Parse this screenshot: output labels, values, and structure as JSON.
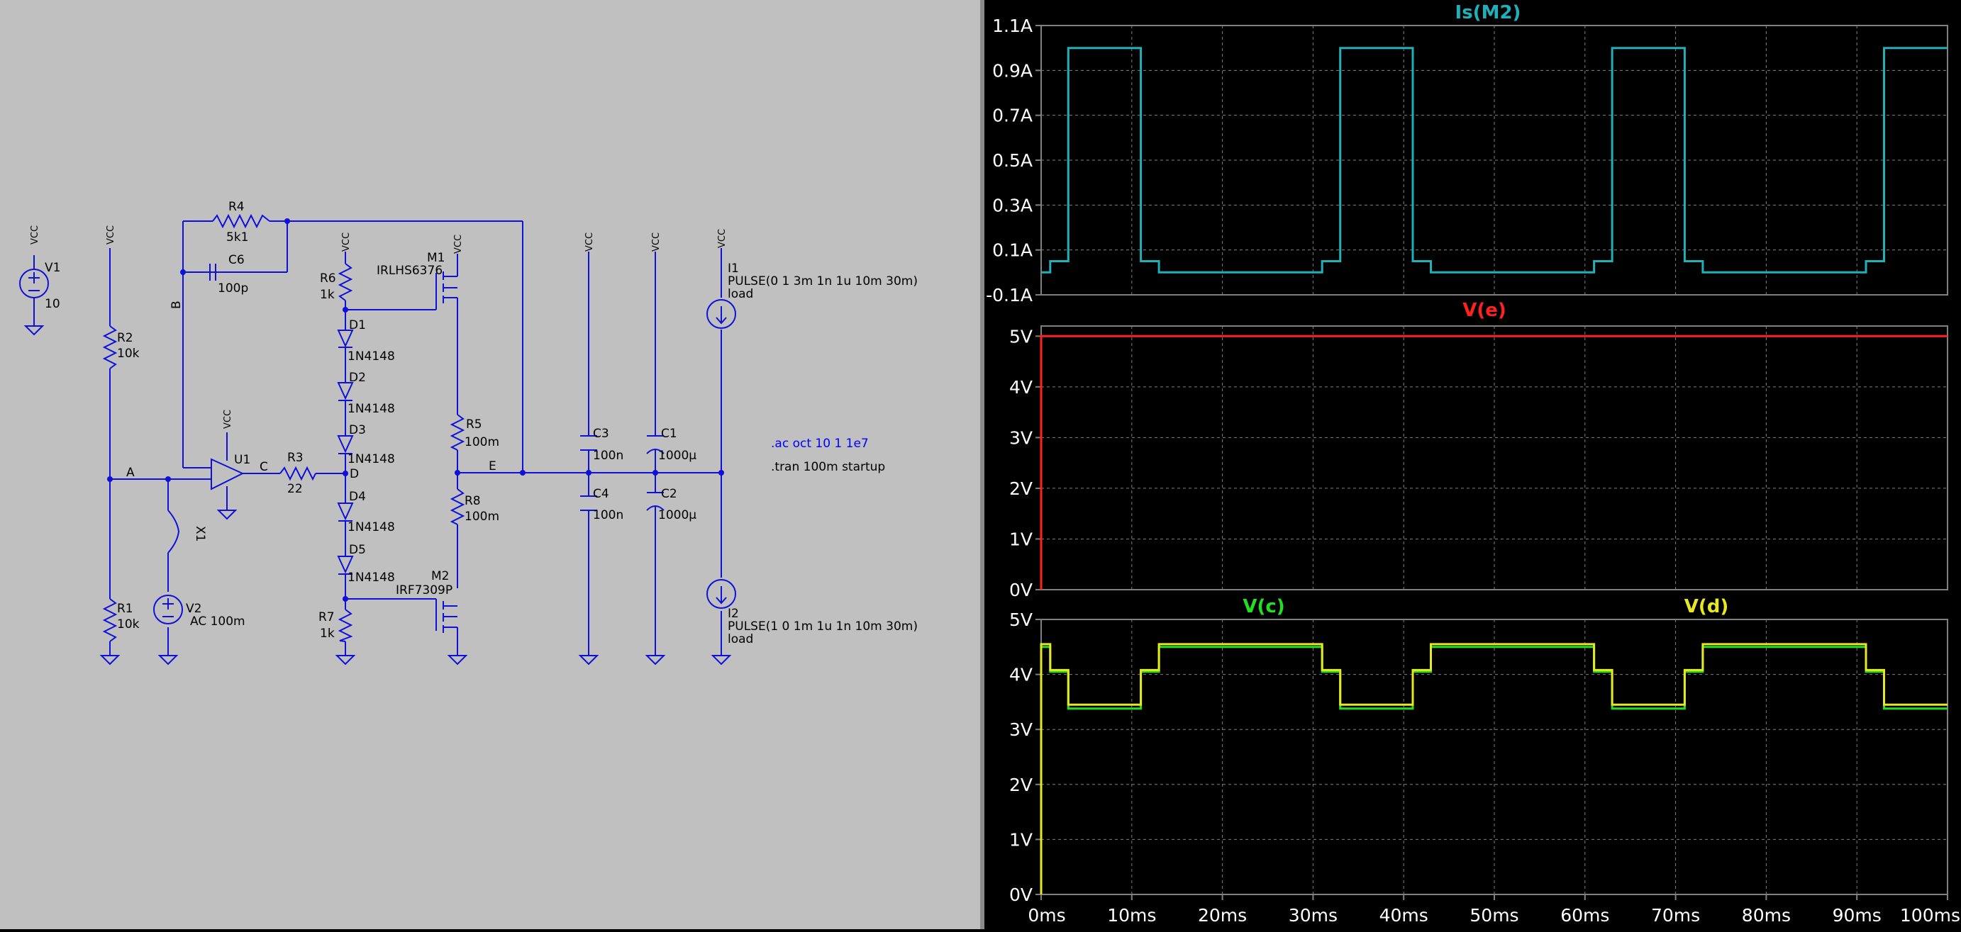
{
  "colors": {
    "schematic_bg": "#c0c0c0",
    "wire": "#1010d8",
    "component": "#1010d8",
    "component_text": "#000000",
    "directive": "#0000ff",
    "plot_bg": "#000000",
    "grid": "#808080",
    "axis_text": "#ffffff",
    "trace_is_m2": "#1fb0b8",
    "trace_ve": "#ff2020",
    "trace_vc": "#20e020",
    "trace_vd": "#e8e820"
  },
  "schematic": {
    "components": [
      {
        "ref": "V1",
        "value": "10",
        "kind": "voltage-source"
      },
      {
        "ref": "V2",
        "value": "AC 100m",
        "kind": "voltage-source"
      },
      {
        "ref": "R1",
        "value": "10k",
        "kind": "resistor"
      },
      {
        "ref": "R2",
        "value": "10k",
        "kind": "resistor"
      },
      {
        "ref": "R3",
        "value": "22",
        "kind": "resistor"
      },
      {
        "ref": "R4",
        "value": "5k1",
        "kind": "resistor"
      },
      {
        "ref": "R5",
        "value": "100m",
        "kind": "resistor"
      },
      {
        "ref": "R6",
        "value": "1k",
        "kind": "resistor"
      },
      {
        "ref": "R7",
        "value": "1k",
        "kind": "resistor"
      },
      {
        "ref": "R8",
        "value": "100m",
        "kind": "resistor"
      },
      {
        "ref": "C1",
        "value": "1000µ",
        "kind": "capacitor"
      },
      {
        "ref": "C2",
        "value": "1000µ",
        "kind": "capacitor"
      },
      {
        "ref": "C3",
        "value": "100n",
        "kind": "capacitor"
      },
      {
        "ref": "C4",
        "value": "100n",
        "kind": "capacitor"
      },
      {
        "ref": "C6",
        "value": "100p",
        "kind": "capacitor"
      },
      {
        "ref": "D1",
        "value": "1N4148",
        "kind": "diode"
      },
      {
        "ref": "D2",
        "value": "1N4148",
        "kind": "diode"
      },
      {
        "ref": "D3",
        "value": "1N4148",
        "kind": "diode"
      },
      {
        "ref": "D4",
        "value": "1N4148",
        "kind": "diode"
      },
      {
        "ref": "D5",
        "value": "1N4148",
        "kind": "diode"
      },
      {
        "ref": "M1",
        "value": "IRLHS6376",
        "kind": "nmos"
      },
      {
        "ref": "M2",
        "value": "IRF7309P",
        "kind": "pmos"
      },
      {
        "ref": "U1",
        "value": "",
        "kind": "opamp"
      },
      {
        "ref": "X1",
        "value": "",
        "kind": "switch"
      },
      {
        "ref": "I1",
        "value": "PULSE(0 1 3m 1n 1u 10m 30m)",
        "extra": "load",
        "kind": "current-source"
      },
      {
        "ref": "I2",
        "value": "PULSE(1 0 1m 1u 1n 10m 30m)",
        "extra": "load",
        "kind": "current-source"
      }
    ],
    "net_labels": [
      "A",
      "B",
      "C",
      "D",
      "E"
    ],
    "vcc_label": "VCC",
    "directives": [
      ".ac oct 10 1 1e7",
      ".tran 100m startup"
    ]
  },
  "plots": {
    "x_ticks": [
      "0ms",
      "10ms",
      "20ms",
      "30ms",
      "40ms",
      "50ms",
      "60ms",
      "70ms",
      "80ms",
      "90ms",
      "100ms"
    ],
    "pane1": {
      "title": "Is(M2)",
      "y_ticks": [
        "1.1A",
        "0.9A",
        "0.7A",
        "0.5A",
        "0.3A",
        "0.1A",
        "-0.1A"
      ],
      "ylim": [
        -0.1,
        1.1
      ]
    },
    "pane2": {
      "title": "V(e)",
      "y_ticks": [
        "5V",
        "4V",
        "3V",
        "2V",
        "1V",
        "0V"
      ],
      "ylim": [
        0,
        5.2
      ]
    },
    "pane3": {
      "title_c": "V(c)",
      "title_d": "V(d)",
      "y_ticks": [
        "5V",
        "4V",
        "3V",
        "2V",
        "1V",
        "0V"
      ],
      "ylim": [
        0,
        5
      ]
    }
  },
  "chart_data": [
    {
      "type": "line",
      "title": "Is(M2)",
      "xlim": [
        0,
        100
      ],
      "ylim": [
        -0.1,
        1.1
      ],
      "series": [
        {
          "name": "Is(M2)",
          "x": [
            0,
            1,
            1,
            3,
            3,
            11,
            11,
            13,
            13,
            31,
            31,
            33,
            33,
            41,
            41,
            43,
            43,
            61,
            61,
            63,
            63,
            71,
            71,
            73,
            73,
            91,
            91,
            93,
            93,
            100
          ],
          "y": [
            0,
            0,
            0.05,
            0.05,
            1.0,
            1.0,
            0.05,
            0.05,
            0.0,
            0.0,
            0.05,
            0.05,
            1.0,
            1.0,
            0.05,
            0.05,
            0.0,
            0.0,
            0.05,
            0.05,
            1.0,
            1.0,
            0.05,
            0.05,
            0.0,
            0.0,
            0.05,
            0.05,
            1.0,
            1.0
          ]
        }
      ]
    },
    {
      "type": "line",
      "title": "V(e)",
      "xlim": [
        0,
        100
      ],
      "ylim": [
        0,
        5.2
      ],
      "series": [
        {
          "name": "V(e)",
          "x": [
            0,
            0,
            100
          ],
          "y": [
            0,
            5.0,
            5.0
          ]
        }
      ]
    },
    {
      "type": "line",
      "xlim": [
        0,
        100
      ],
      "ylim": [
        0,
        5
      ],
      "series": [
        {
          "name": "V(c)",
          "x": [
            0,
            0,
            1,
            1,
            3,
            3,
            11,
            11,
            13,
            13,
            31,
            31,
            33,
            33,
            41,
            41,
            43,
            43,
            61,
            61,
            63,
            63,
            71,
            71,
            73,
            73,
            91,
            91,
            93,
            93,
            100
          ],
          "y": [
            0,
            4.5,
            4.5,
            4.05,
            4.05,
            3.38,
            3.38,
            4.05,
            4.05,
            4.5,
            4.5,
            4.05,
            4.05,
            3.38,
            3.38,
            4.05,
            4.05,
            4.5,
            4.5,
            4.05,
            4.05,
            3.38,
            3.38,
            4.05,
            4.05,
            4.5,
            4.5,
            4.05,
            4.05,
            3.38,
            3.38
          ]
        },
        {
          "name": "V(d)",
          "x": [
            0,
            0,
            1,
            1,
            3,
            3,
            11,
            11,
            13,
            13,
            31,
            31,
            33,
            33,
            41,
            41,
            43,
            43,
            61,
            61,
            63,
            63,
            71,
            71,
            73,
            73,
            91,
            91,
            93,
            93,
            100
          ],
          "y": [
            0,
            4.55,
            4.55,
            4.08,
            4.08,
            3.45,
            3.45,
            4.08,
            4.08,
            4.55,
            4.55,
            4.08,
            4.08,
            3.45,
            3.45,
            4.08,
            4.08,
            4.55,
            4.55,
            4.08,
            4.08,
            3.45,
            3.45,
            4.08,
            4.08,
            4.55,
            4.55,
            4.08,
            4.08,
            3.45,
            3.45
          ]
        }
      ]
    }
  ]
}
